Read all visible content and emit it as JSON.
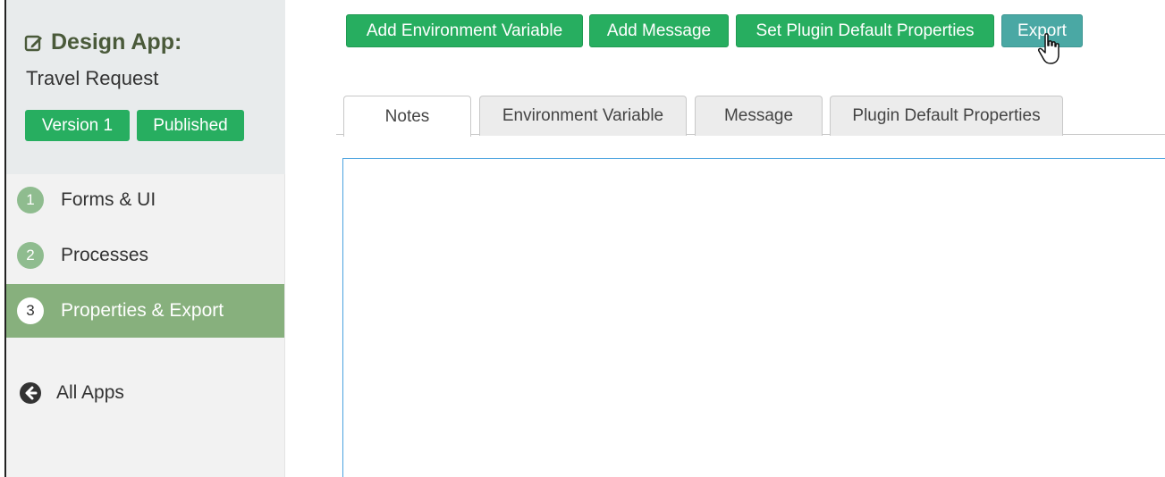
{
  "sidebar": {
    "title": "Design App:",
    "app_name": "Travel Request",
    "version_badge": "Version 1",
    "status_badge": "Published",
    "nav": [
      {
        "num": "1",
        "label": "Forms & UI"
      },
      {
        "num": "2",
        "label": "Processes"
      },
      {
        "num": "3",
        "label": "Properties & Export"
      }
    ],
    "all_apps": "All Apps"
  },
  "toolbar": {
    "add_env": "Add Environment Variable",
    "add_msg": "Add Message",
    "set_plugin": "Set Plugin Default Properties",
    "export": "Export"
  },
  "tabs": [
    {
      "label": "Notes"
    },
    {
      "label": "Environment Variable"
    },
    {
      "label": "Message"
    },
    {
      "label": "Plugin Default Properties"
    }
  ],
  "notes": {
    "value": ""
  },
  "colors": {
    "primary_green": "#27ae60",
    "export_teal": "#4aa8a4",
    "active_nav": "#87b07d",
    "focus_border": "#4aa3df"
  }
}
